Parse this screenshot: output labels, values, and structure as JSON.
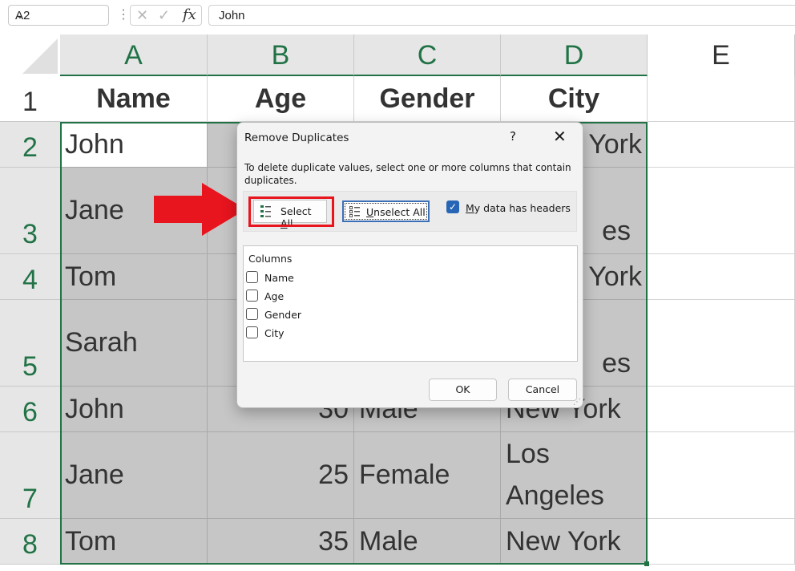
{
  "formula_bar": {
    "name_box": "A2",
    "fx": "fx",
    "content": "John"
  },
  "columns": [
    "A",
    "B",
    "C",
    "D",
    "E"
  ],
  "rows": [
    "1",
    "2",
    "3",
    "4",
    "5",
    "6",
    "7",
    "8"
  ],
  "cells": {
    "header": [
      "Name",
      "Age",
      "Gender",
      "City"
    ],
    "r2": {
      "a": "John",
      "d": "York"
    },
    "r3": {
      "a": "Jane",
      "d": "es"
    },
    "r4": {
      "a": "Tom",
      "d": "York"
    },
    "r5": {
      "a": "Sarah",
      "d": "es"
    },
    "r6": {
      "a": "John",
      "b": "30",
      "c": "Male",
      "d": "New York"
    },
    "r7": {
      "a": "Jane",
      "b": "25",
      "c": "Female",
      "d1": "Los",
      "d2": "Angeles"
    },
    "r8": {
      "a": "Tom",
      "b": "35",
      "c": "Male",
      "d": "New York"
    }
  },
  "dialog": {
    "title": "Remove Duplicates",
    "help": "?",
    "close": "✕",
    "description": "To delete duplicate values, select one or more columns that contain duplicates.",
    "select_all": {
      "pre": "Select ",
      "key": "A",
      "post": "ll"
    },
    "unselect_all": {
      "key": "U",
      "post": "nselect All"
    },
    "headers_checkbox": {
      "key": "M",
      "post": "y data has headers",
      "checked": true
    },
    "columns_caption": "Columns",
    "columns": [
      "Name",
      "Age",
      "Gender",
      "City"
    ],
    "ok": "OK",
    "cancel": "Cancel"
  },
  "colors": {
    "accent": "#217346",
    "highlight_red": "#e8141e",
    "checkbox_blue": "#2766b6"
  }
}
